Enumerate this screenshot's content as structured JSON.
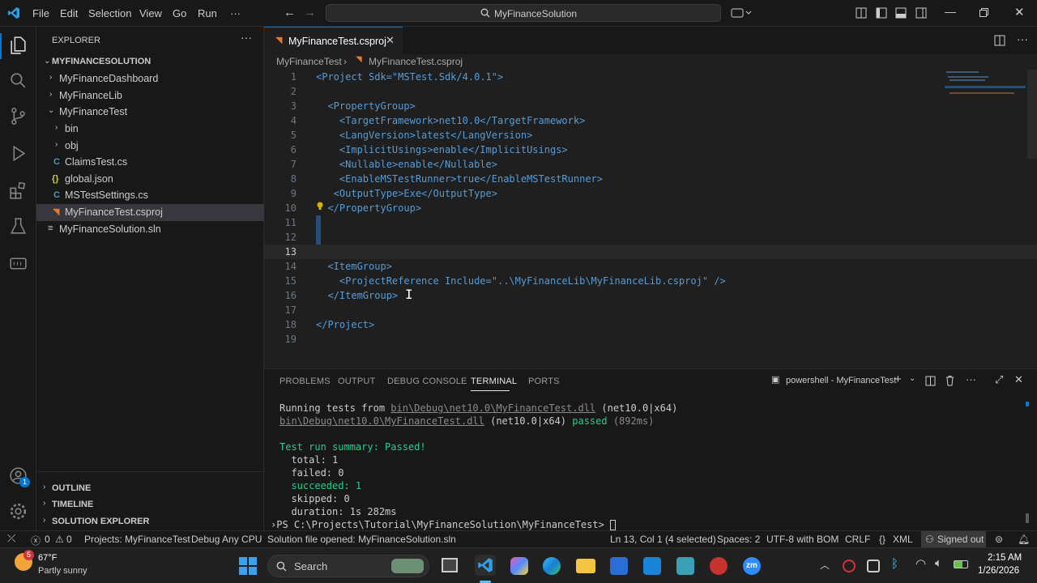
{
  "titlebar": {
    "menus": [
      "File",
      "Edit",
      "Selection",
      "View",
      "Go",
      "Run",
      "···"
    ],
    "search_text": "MyFinanceSolution"
  },
  "sidebar": {
    "title": "EXPLORER",
    "root": "MYFINANCESOLUTION",
    "items": [
      {
        "label": "MyFinanceDashboard"
      },
      {
        "label": "MyFinanceLib"
      },
      {
        "label": "MyFinanceTest"
      },
      {
        "label": "bin"
      },
      {
        "label": "obj"
      },
      {
        "label": "ClaimsTest.cs",
        "icon": "C"
      },
      {
        "label": "global.json",
        "icon": "{ }"
      },
      {
        "label": "MSTestSettings.cs",
        "icon": "C"
      },
      {
        "label": "MyFinanceTest.csproj",
        "icon": "rss"
      },
      {
        "label": "MyFinanceSolution.sln",
        "icon": "≡"
      }
    ],
    "sections": [
      "OUTLINE",
      "TIMELINE",
      "SOLUTION EXPLORER"
    ]
  },
  "editor": {
    "tab_label": "MyFinanceTest.csproj",
    "breadcrumb": [
      "MyFinanceTest",
      "MyFinanceTest.csproj"
    ],
    "line_numbers": [
      "1",
      "2",
      "3",
      "4",
      "5",
      "6",
      "7",
      "8",
      "9",
      "10",
      "11",
      "12",
      "13",
      "14",
      "15",
      "16",
      "17",
      "18",
      "19"
    ],
    "current_line": "13",
    "lines": [
      "<Project Sdk=\"MSTest.Sdk/4.0.1\">",
      "",
      "  <PropertyGroup>",
      "    <TargetFramework>net10.0</TargetFramework>",
      "    <LangVersion>latest</LangVersion>",
      "    <ImplicitUsings>enable</ImplicitUsings>",
      "    <Nullable>enable</Nullable>",
      "    <EnableMSTestRunner>true</EnableMSTestRunner>",
      "   <OutputType>Exe</OutputType>",
      "  </PropertyGroup>",
      "",
      "",
      "",
      "  <ItemGroup>",
      "    <ProjectReference Include=\"..\\MyFinanceLib\\MyFinanceLib.csproj\" />",
      "  </ItemGroup>",
      "",
      "</Project>",
      ""
    ]
  },
  "panel": {
    "tabs": [
      "PROBLEMS",
      "OUTPUT",
      "DEBUG CONSOLE",
      "TERMINAL",
      "PORTS"
    ],
    "active_tab": "TERMINAL",
    "terminal_name": "powershell - MyFinanceTest",
    "terminal": {
      "line1_prefix": "Running tests from ",
      "line1_path": "bin\\Debug\\net10.0\\MyFinanceTest.dll",
      "line1_suffix": " (net10.0|x64)",
      "line2_path": "bin\\Debug\\net10.0\\MyFinanceTest.dll",
      "line2_mid": " (net10.0|x64) ",
      "line2_passed": "passed",
      "line2_time": " (892ms)",
      "summary": "Test run summary: Passed!",
      "total": "  total: 1",
      "failed": "  failed: 0",
      "succeeded": "  succeeded: 1",
      "skipped": "  skipped: 0",
      "duration": "  duration: 1s 282ms",
      "prompt": "PS C:\\Projects\\Tutorial\\MyFinanceSolution\\MyFinanceTest> "
    }
  },
  "statusbar": {
    "errors": "0",
    "warnings": "0",
    "projects": "Projects: MyFinanceTest",
    "config": "Debug Any CPU",
    "solution_msg": "Solution file opened: MyFinanceSolution.sln",
    "position": "Ln 13, Col 1 (4 selected)",
    "spaces": "Spaces: 2",
    "encoding": "UTF-8 with BOM",
    "eol": "CRLF",
    "language": "XML",
    "account": "Signed out"
  },
  "taskbar": {
    "weather_temp": "67°F",
    "weather_desc": "Partly sunny",
    "weather_badge": "5",
    "search_label": "Search",
    "time": "2:15 AM",
    "date": "1/26/2026"
  },
  "colors": {
    "accent": "#0078d4",
    "tag": "#569cd6",
    "string": "#ce9178",
    "attr": "#9cdcfe",
    "pass": "#23d18b"
  }
}
